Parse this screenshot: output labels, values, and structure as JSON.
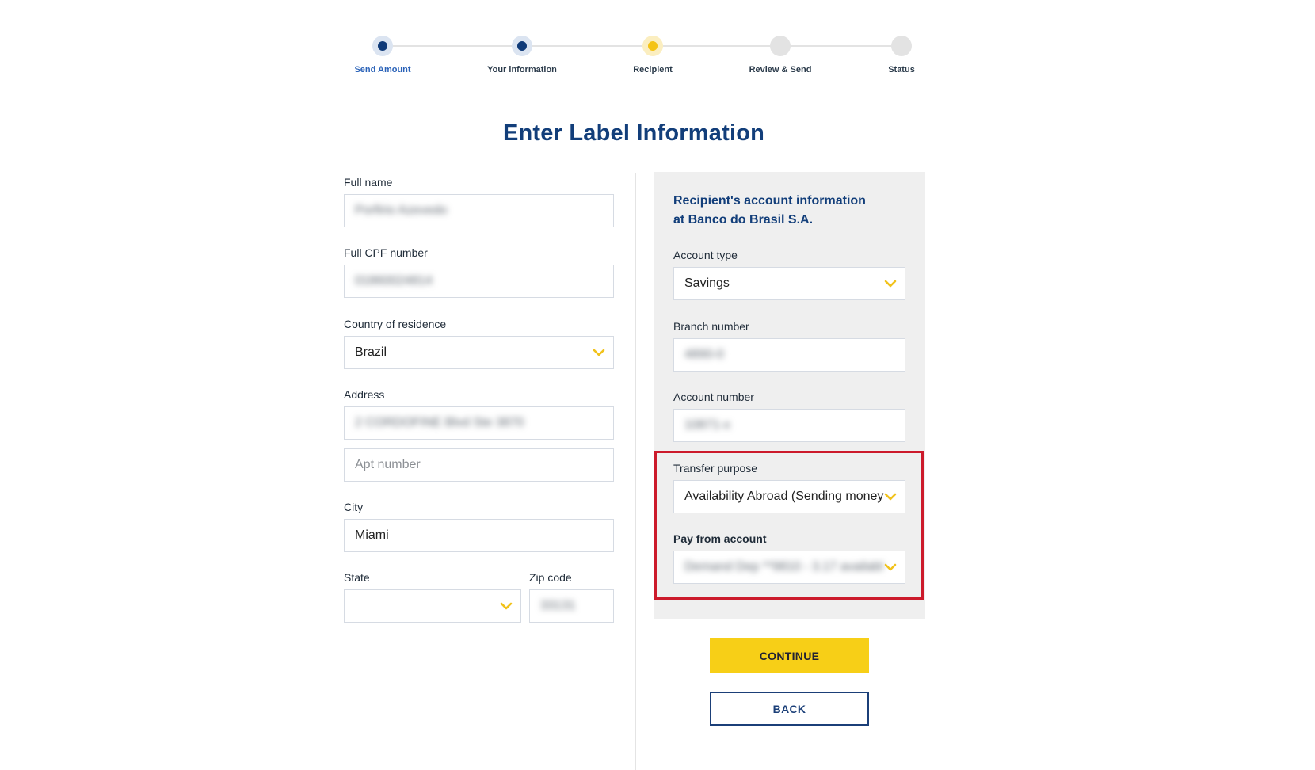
{
  "steps": [
    {
      "label": "Send Amount",
      "state": "done"
    },
    {
      "label": "Your information",
      "state": "done"
    },
    {
      "label": "Recipient",
      "state": "current"
    },
    {
      "label": "Review & Send",
      "state": "pending"
    },
    {
      "label": "Status",
      "state": "pending"
    }
  ],
  "page_title": "Enter Label Information",
  "left_form": {
    "full_name": {
      "label": "Full name",
      "value": "Porfirio Azevedo"
    },
    "cpf": {
      "label": "Full CPF number",
      "value": "01860024814"
    },
    "country": {
      "label": "Country of residence",
      "value": "Brazil"
    },
    "address": {
      "label": "Address",
      "value": "2 CORDOFINE Blvd Ste 3870"
    },
    "apt": {
      "placeholder": "Apt number"
    },
    "city": {
      "label": "City",
      "value": "Miami"
    },
    "state": {
      "label": "State",
      "value": ""
    },
    "zip": {
      "label": "Zip code",
      "value": "33131"
    }
  },
  "right_panel": {
    "title_line1": "Recipient's account information",
    "title_line2": "at Banco do Brasil S.A.",
    "account_type": {
      "label": "Account type",
      "value": "Savings"
    },
    "branch": {
      "label": "Branch number",
      "value": "4890-0"
    },
    "account_number": {
      "label": "Account number",
      "value": "10871-x"
    },
    "transfer_purpose": {
      "label": "Transfer purpose",
      "value": "Availability Abroad (Sending money"
    },
    "pay_from": {
      "label": "Pay from account",
      "value": "Demand Dep **9810 - 3.17 availabl"
    }
  },
  "buttons": {
    "continue": "CONTINUE",
    "back": "BACK"
  },
  "colors": {
    "brand_blue": "#123e7a",
    "accent_yellow": "#f7cf17",
    "highlight_red": "#cc1a2b"
  }
}
